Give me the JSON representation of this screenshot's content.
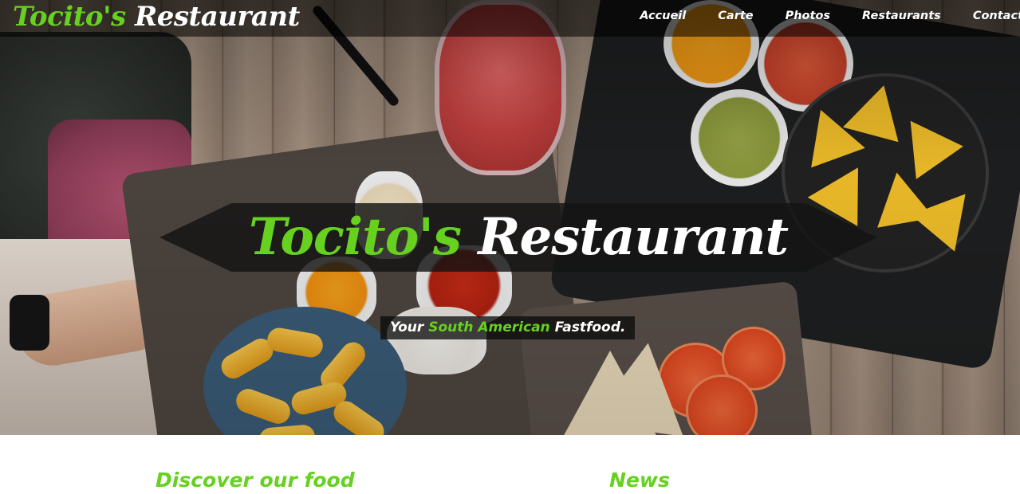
{
  "header": {
    "brand_part1": "Tocito's",
    "brand_part2": "Restaurant"
  },
  "nav": {
    "items": [
      "Accueil",
      "Carte",
      "Photos",
      "Restaurants",
      "Contact"
    ]
  },
  "hero": {
    "title_part1": "Tocito's",
    "title_part2": "Restaurant",
    "tagline": {
      "before": "Your",
      "highlight": "South American",
      "after": "Fastfood."
    }
  },
  "sections": {
    "discover": "Discover our food",
    "news": "News"
  },
  "colors": {
    "accent_green": "#66d11f",
    "text_white": "#ffffff",
    "overlay_dark": "#141414"
  },
  "icons": {
    "hero_image": "food-table-photo"
  }
}
